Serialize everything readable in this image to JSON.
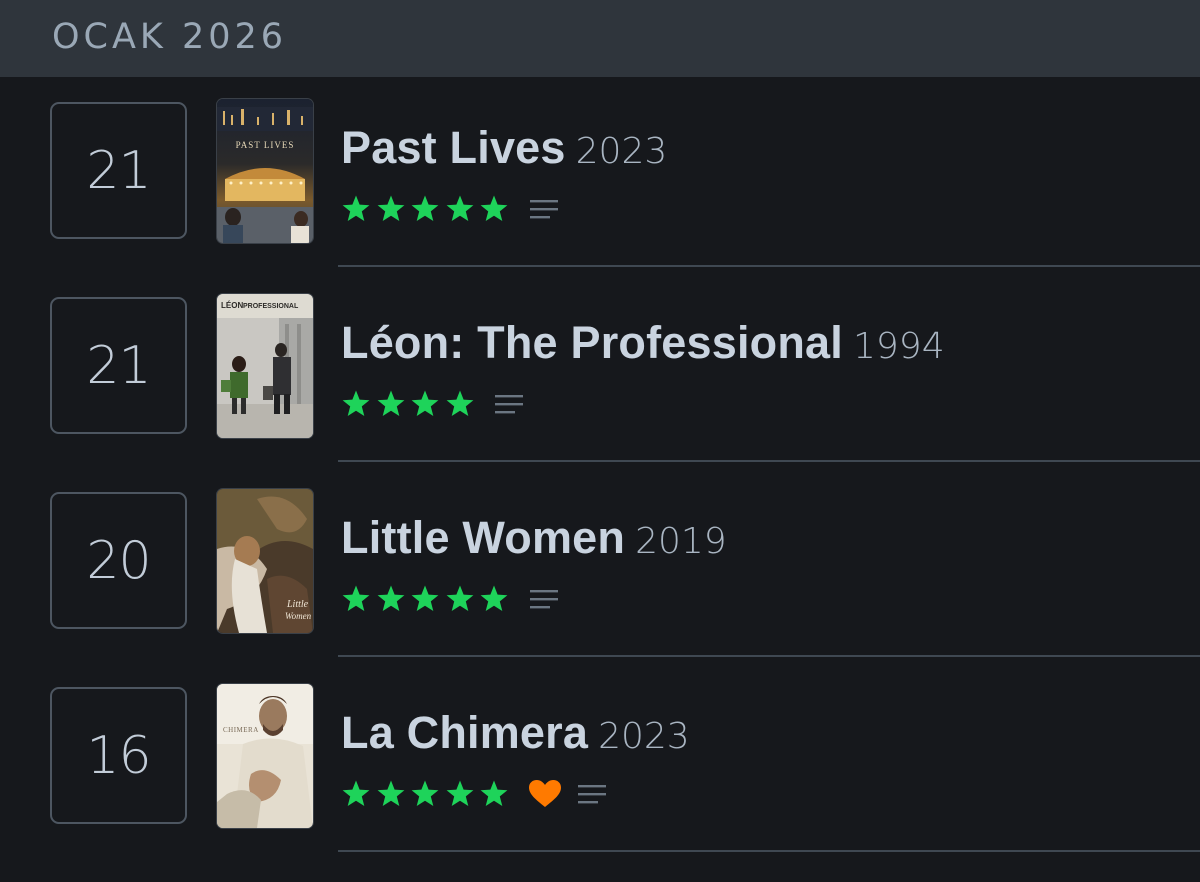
{
  "month_header": {
    "label": "OCAK 2026"
  },
  "entries": [
    {
      "day": "21",
      "title": "Past Lives",
      "year": "2023",
      "rating": 5,
      "liked": false,
      "poster_icon": "past-lives-poster"
    },
    {
      "day": "21",
      "title": "Léon: The Professional",
      "year": "1994",
      "rating": 4,
      "liked": false,
      "poster_icon": "leon-poster"
    },
    {
      "day": "20",
      "title": "Little Women",
      "year": "2019",
      "rating": 5,
      "liked": false,
      "poster_icon": "little-women-poster"
    },
    {
      "day": "16",
      "title": "La Chimera",
      "year": "2023",
      "rating": 5,
      "liked": true,
      "poster_icon": "la-chimera-poster"
    }
  ],
  "colors": {
    "background": "#16181c",
    "header_bg": "#2f353c",
    "star": "#1ed35a",
    "heart": "#ff7a00",
    "title": "#c9d3df"
  }
}
